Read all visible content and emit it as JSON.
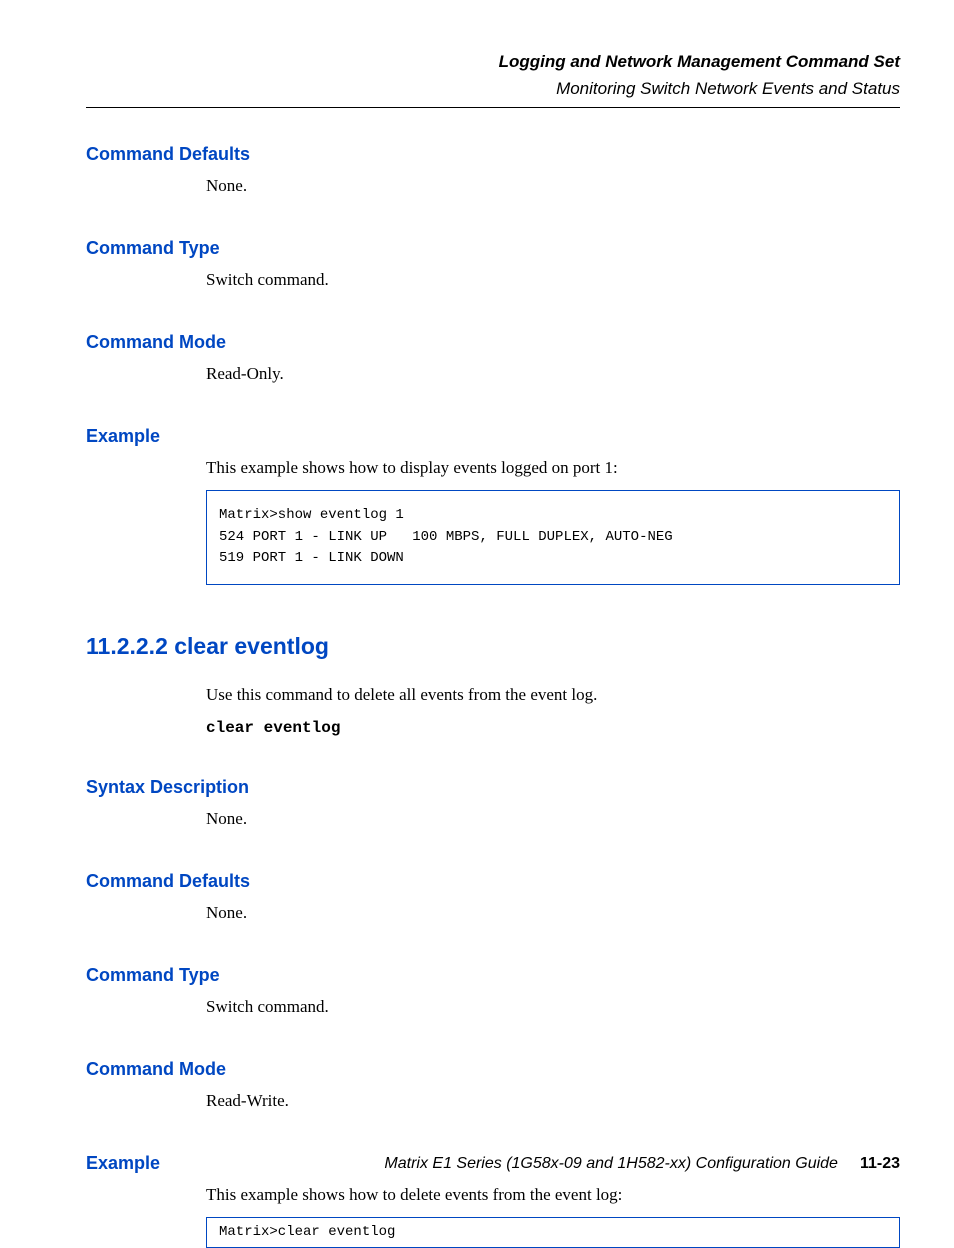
{
  "header": {
    "title": "Logging and Network Management Command Set",
    "subtitle": "Monitoring Switch Network Events and Status"
  },
  "sec1": {
    "h_defaults": "Command Defaults",
    "defaults_body": "None.",
    "h_type": "Command Type",
    "type_body": "Switch command.",
    "h_mode": "Command Mode",
    "mode_body": "Read-Only.",
    "h_example": "Example",
    "example_body": "This example shows how to display events logged on port 1:",
    "example_code": "Matrix>show eventlog 1\n524 PORT 1 - LINK UP   100 MBPS, FULL DUPLEX, AUTO-NEG\n519 PORT 1 - LINK DOWN"
  },
  "sec2": {
    "title": "11.2.2.2  clear eventlog",
    "intro": "Use this command to delete all events from the event log.",
    "cmd": "clear eventlog",
    "h_syntax": "Syntax Description",
    "syntax_body": "None.",
    "h_defaults": "Command Defaults",
    "defaults_body": "None.",
    "h_type": "Command Type",
    "type_body": "Switch command.",
    "h_mode": "Command Mode",
    "mode_body": "Read-Write.",
    "h_example": "Example",
    "example_body": "This example shows how to delete events from the event log:",
    "example_code": "Matrix>clear eventlog"
  },
  "footer": {
    "guide": "Matrix E1 Series (1G58x-09 and 1H582-xx) Configuration Guide",
    "page": "11-23"
  }
}
